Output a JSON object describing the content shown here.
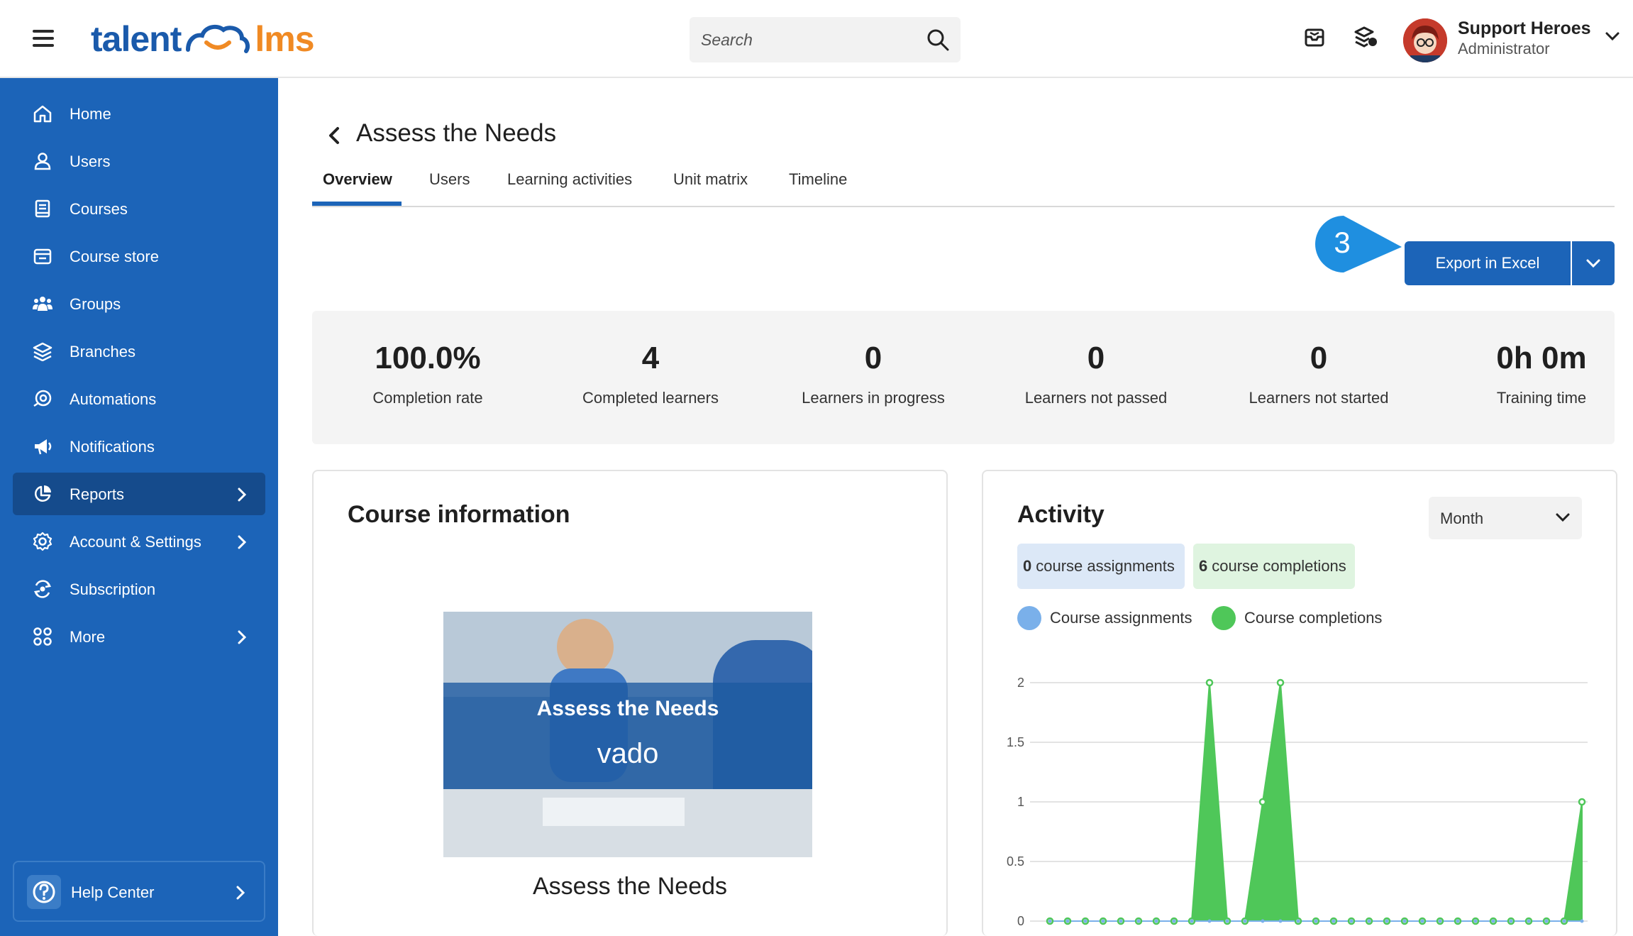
{
  "header": {
    "logo_left": "talent",
    "logo_right": "lms",
    "search_placeholder": "Search",
    "user_name": "Support Heroes",
    "user_role": "Administrator"
  },
  "sidebar": {
    "items": [
      {
        "label": "Home",
        "icon": "home-icon"
      },
      {
        "label": "Users",
        "icon": "user-icon"
      },
      {
        "label": "Courses",
        "icon": "book-icon"
      },
      {
        "label": "Course store",
        "icon": "store-icon"
      },
      {
        "label": "Groups",
        "icon": "group-icon"
      },
      {
        "label": "Branches",
        "icon": "layers-icon"
      },
      {
        "label": "Automations",
        "icon": "automation-icon"
      },
      {
        "label": "Notifications",
        "icon": "megaphone-icon"
      },
      {
        "label": "Reports",
        "icon": "pie-chart-icon"
      },
      {
        "label": "Account & Settings",
        "icon": "gear-icon"
      },
      {
        "label": "Subscription",
        "icon": "subscription-icon"
      },
      {
        "label": "More",
        "icon": "grid-icon"
      }
    ],
    "help_label": "Help Center"
  },
  "page": {
    "title": "Assess the Needs",
    "tabs": [
      "Overview",
      "Users",
      "Learning activities",
      "Unit matrix",
      "Timeline"
    ],
    "callout_number": "3",
    "export_label": "Export in Excel"
  },
  "stats": [
    {
      "value": "100.0%",
      "label": "Completion rate"
    },
    {
      "value": "4",
      "label": "Completed learners"
    },
    {
      "value": "0",
      "label": "Learners in progress"
    },
    {
      "value": "0",
      "label": "Learners not passed"
    },
    {
      "value": "0",
      "label": "Learners not started"
    },
    {
      "value": "0h 0m",
      "label": "Training time"
    }
  ],
  "course_info": {
    "title": "Course information",
    "image_title": "Assess the Needs",
    "image_brand": "vado",
    "course_name": "Assess the Needs"
  },
  "activity": {
    "title": "Activity",
    "period": "Month",
    "assignments_count": "0",
    "assignments_text": "course assignments",
    "completions_count": "6",
    "completions_text": "course completions",
    "legend_assignments": "Course assignments",
    "legend_completions": "Course completions"
  },
  "colors": {
    "brand_blue": "#1c64b8",
    "sidebar_active": "#154b8c",
    "assignments": "#7ab0ea",
    "completions": "#4fc759",
    "logo_orange": "#f08a24"
  },
  "chart_data": {
    "type": "area",
    "ylim": [
      0,
      2
    ],
    "yticks": [
      "0",
      "0.5",
      "1",
      "1.5",
      "2"
    ],
    "series": [
      {
        "name": "Course completions",
        "values": [
          0,
          0,
          0,
          0,
          0,
          0,
          0,
          0,
          0,
          2,
          0,
          0,
          1,
          2,
          0,
          0,
          0,
          0,
          0,
          0,
          0,
          0,
          0,
          0,
          0,
          0,
          0,
          0,
          0,
          0,
          1
        ]
      },
      {
        "name": "Course assignments",
        "values": [
          0,
          0,
          0,
          0,
          0,
          0,
          0,
          0,
          0,
          0,
          0,
          0,
          0,
          0,
          0,
          0,
          0,
          0,
          0,
          0,
          0,
          0,
          0,
          0,
          0,
          0,
          0,
          0,
          0,
          0,
          0
        ]
      }
    ]
  }
}
